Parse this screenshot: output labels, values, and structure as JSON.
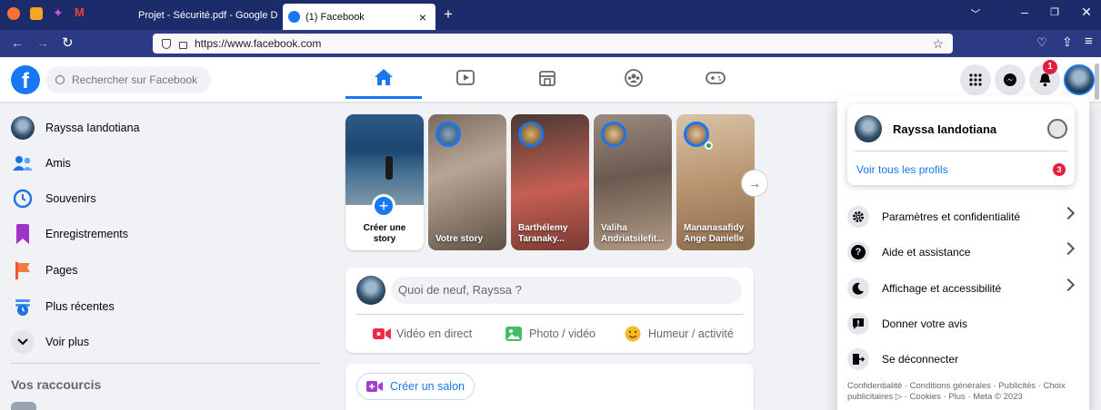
{
  "browser": {
    "tabs": [
      {
        "label": "Projet - Sécurité.pdf - Google D"
      },
      {
        "label": "(1) Facebook"
      }
    ],
    "url": "https://www.facebook.com",
    "new_tab": "+"
  },
  "search": {
    "placeholder": "Rechercher sur Facebook"
  },
  "header": {
    "notification_count": "1"
  },
  "sidebar": {
    "items": [
      {
        "label": "Rayssa Iandotiana",
        "icon": "avatar"
      },
      {
        "label": "Amis",
        "icon": "friends-icon"
      },
      {
        "label": "Souvenirs",
        "icon": "memories-icon"
      },
      {
        "label": "Enregistrements",
        "icon": "bookmark-icon"
      },
      {
        "label": "Pages",
        "icon": "flag-icon"
      },
      {
        "label": "Plus récentes",
        "icon": "recent-icon"
      },
      {
        "label": "Voir plus",
        "icon": "chevron-down-icon"
      }
    ],
    "shortcuts_title": "Vos raccourcis"
  },
  "stories": [
    {
      "label": "Créer une story"
    },
    {
      "label": "Votre story"
    },
    {
      "label": "Barthélemy Taranaky..."
    },
    {
      "label": "Valiha Andriatsilefit..."
    },
    {
      "label": "Mananasafidy Ange Danielle"
    }
  ],
  "composer": {
    "placeholder": "Quoi de neuf, Rayssa ?",
    "live": "Vidéo en direct",
    "photo": "Photo / vidéo",
    "feeling": "Humeur / activité"
  },
  "room": {
    "label": "Créer un salon"
  },
  "dropdown": {
    "profile_name": "Rayssa Iandotiana",
    "see_profiles": "Voir tous les profils",
    "profiles_badge": "3",
    "items": [
      {
        "label": "Paramètres et confidentialité"
      },
      {
        "label": "Aide et assistance"
      },
      {
        "label": "Affichage et accessibilité"
      },
      {
        "label": "Donner votre avis"
      },
      {
        "label": "Se déconnecter"
      }
    ],
    "footer": "Confidentialité · Conditions générales · Publicités · Choix publicitaires ▷ · Cookies · Plus · Meta © 2023"
  },
  "colors": {
    "brand": "#1877f2",
    "browser": "#1c2c6b",
    "notification": "#e41e3f"
  }
}
